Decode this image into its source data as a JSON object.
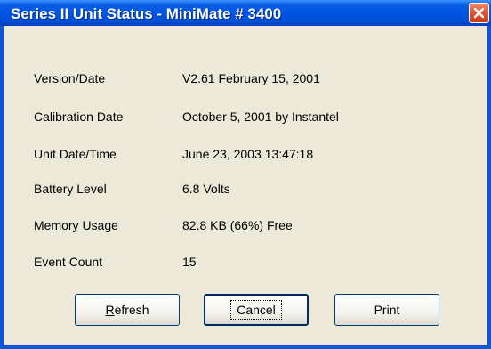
{
  "window": {
    "title": "Series II Unit Status - MiniMate # 3400"
  },
  "title_bar": {
    "close_icon": "close-x-icon"
  },
  "status_rows": [
    {
      "label": "Version/Date",
      "value": "V2.61  February 15, 2001"
    },
    {
      "label": "Calibration Date",
      "value": "October 5, 2001 by Instantel"
    },
    {
      "label": "Unit Date/Time",
      "value": "June 23, 2003  13:47:18"
    },
    {
      "label": "Battery Level",
      "value": "6.8 Volts"
    },
    {
      "label": "Memory Usage",
      "value": "82.8 KB  (66%) Free"
    },
    {
      "label": "Event Count",
      "value": "15"
    }
  ],
  "buttons": {
    "refresh_mnemonic": "R",
    "refresh_rest": "efresh",
    "cancel": "Cancel",
    "print": "Print"
  },
  "colors": {
    "title_bar": "#0054e3",
    "window_border": "#0a58d8",
    "dialog_background": "#ece9d8",
    "close_button": "#e2502e"
  }
}
